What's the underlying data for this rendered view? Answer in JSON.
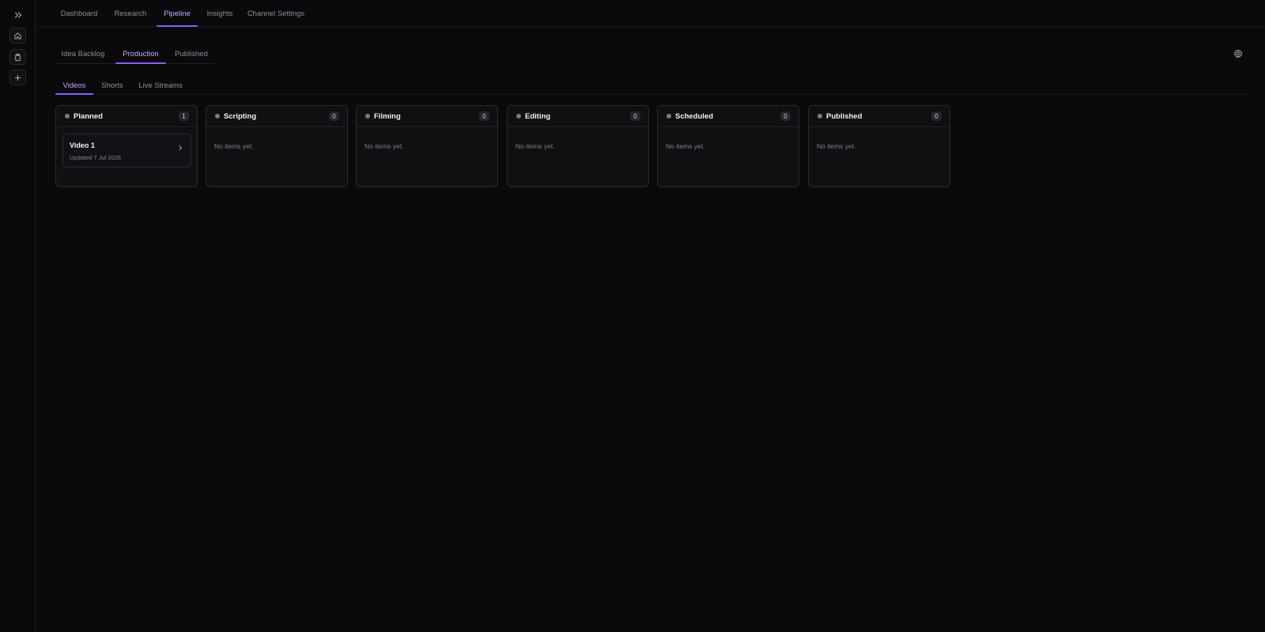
{
  "rail": {
    "icons": [
      "chevrons-right-icon",
      "home-icon",
      "clipboard-icon",
      "plus-icon"
    ]
  },
  "topnav": {
    "tabs": [
      {
        "label": "Dashboard"
      },
      {
        "label": "Research"
      },
      {
        "label": "Pipeline"
      },
      {
        "label": "Insights"
      },
      {
        "label": "Channel Settings"
      }
    ],
    "active": "Pipeline"
  },
  "subnav": {
    "tabs": [
      {
        "label": "Idea Backlog"
      },
      {
        "label": "Production"
      },
      {
        "label": "Published"
      }
    ],
    "active": "Production"
  },
  "typenav": {
    "tabs": [
      {
        "label": "Videos"
      },
      {
        "label": "Shorts"
      },
      {
        "label": "Live Streams"
      }
    ],
    "active": "Videos"
  },
  "board": {
    "columns": [
      {
        "title": "Planned",
        "count": "1",
        "cards": [
          {
            "title": "Video 1",
            "updated": "Updated 7 Jul 2026"
          }
        ]
      },
      {
        "title": "Scripting",
        "count": "0",
        "empty": "No items yet."
      },
      {
        "title": "Filming",
        "count": "0",
        "empty": "No items yet."
      },
      {
        "title": "Editing",
        "count": "0",
        "empty": "No items yet."
      },
      {
        "title": "Scheduled",
        "count": "0",
        "empty": "No items yet."
      },
      {
        "title": "Published",
        "count": "0",
        "empty": "No items yet."
      }
    ]
  },
  "colors": {
    "accent": "#8f5bff",
    "accent_text": "#c4a6ff",
    "background": "#0a0a0c",
    "column_bg": "#101013"
  }
}
